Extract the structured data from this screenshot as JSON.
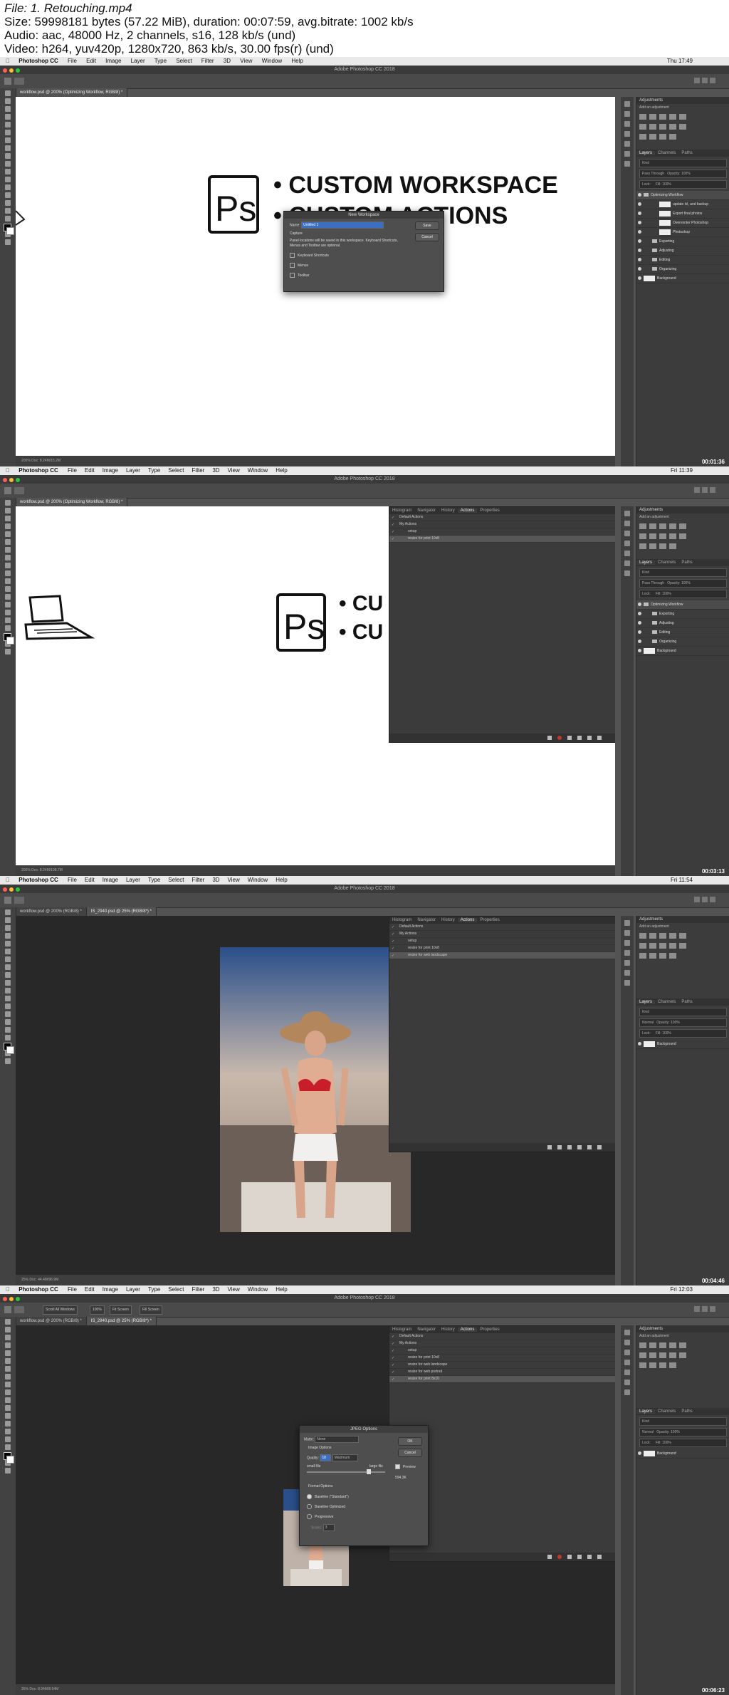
{
  "header": {
    "file": "File: 1. Retouching.mp4",
    "size": "Size: 59998181 bytes (57.22 MiB), duration: 00:07:59, avg.bitrate: 1002 kb/s",
    "audio": "Audio: aac, 48000 Hz, 2 channels, s16, 128 kb/s (und)",
    "video": "Video: h264, yuv420p, 1280x720, 863 kb/s, 30.00 fps(r) (und)"
  },
  "menu": {
    "app": "Photoshop CC",
    "items": [
      "File",
      "Edit",
      "Image",
      "Layer",
      "Type",
      "Select",
      "Filter",
      "3D",
      "View",
      "Window",
      "Help"
    ]
  },
  "window_title": "Adobe Photoshop CC 2018",
  "panels": {
    "adjustments": "Adjustments",
    "add_adjustment": "Add an adjustment",
    "layers_tabs": [
      "Layers",
      "Channels",
      "Paths"
    ],
    "kind": "Kind",
    "pass_through": "Pass Through",
    "normal": "Normal",
    "opacity": "Opacity: 100%",
    "lock": "Lock:",
    "fill": "Fill: 100%",
    "action_tabs": [
      "Histogram",
      "Navigator",
      "History",
      "Actions",
      "Properties"
    ]
  },
  "frames": [
    {
      "clock": "Thu 17:49",
      "tabs": [
        "workflow.psd @ 200% (Optimizing Workflow, RGB/8) *"
      ],
      "status": "200%    Doc: 8.24M/15.2M",
      "timestamp": "00:01:36",
      "drawing": {
        "line1": "• CUSTOM WORKSPACE",
        "line2": "• CUSTOM ACTIONS",
        "logo": "Ps"
      },
      "dialog": {
        "title": "New Workspace",
        "name_label": "Name:",
        "name_value": "Untitled 1",
        "save": "Save",
        "cancel": "Cancel",
        "capture": "Capture",
        "note": "Panel locations will be saved in this workspace. Keyboard Shortcuts, Menus and Toolbar are optional.",
        "options": [
          "Keyboard Shortcuts",
          "Menus",
          "Toolbar"
        ]
      },
      "layers": [
        {
          "name": "Optimizing Workflow",
          "type": "group"
        },
        {
          "name": "update lvl, and backup",
          "type": "sub-layer"
        },
        {
          "name": "Export final photos",
          "type": "sub-layer"
        },
        {
          "name": "Overexnter Photoshop",
          "type": "sub-layer"
        },
        {
          "name": "Photoshop",
          "type": "sub-layer"
        },
        {
          "name": "Exporting",
          "type": "sub-group"
        },
        {
          "name": "Adjusting",
          "type": "sub-group"
        },
        {
          "name": "Editing",
          "type": "sub-group"
        },
        {
          "name": "Organizing",
          "type": "sub-group"
        },
        {
          "name": "Background",
          "type": "layer"
        }
      ]
    },
    {
      "clock": "Fri 11:39",
      "tabs": [
        "workflow.psd @ 200% (Optimizing Workflow, RGB/8) *"
      ],
      "status": "200%    Doc: 8.24M/108.7M",
      "timestamp": "00:03:13",
      "drawing": {
        "line1": "• CU",
        "line2": "• CU",
        "logo": "Ps"
      },
      "actions": [
        "Default Actions",
        "My Actions",
        "setup",
        "resize for print 10x8"
      ],
      "layers": [
        {
          "name": "Optimizing Workflow",
          "type": "group"
        },
        {
          "name": "Exporting",
          "type": "sub-group"
        },
        {
          "name": "Adjusting",
          "type": "sub-group"
        },
        {
          "name": "Editing",
          "type": "sub-group"
        },
        {
          "name": "Organizing",
          "type": "sub-group"
        },
        {
          "name": "Background",
          "type": "layer"
        }
      ]
    },
    {
      "clock": "Fri 11:54",
      "tabs": [
        "workflow.psd @ 200% (RGB/8) *",
        "IS_2940.psd @ 25% (RGB/8*) *"
      ],
      "status": "25%    Doc: 44.4M/96.9M",
      "timestamp": "00:04:46",
      "actions": [
        "Default Actions",
        "My Actions",
        "setup",
        "resize for print 10x8",
        "resize for web landscape"
      ],
      "layers": [
        {
          "name": "Background",
          "type": "layer"
        }
      ]
    },
    {
      "clock": "Fri 12:03",
      "tabs": [
        "workflow.psd @ 200% (RGB/8) *",
        "IS_2940.psd @ 25% (RGB/8*) *"
      ],
      "status": "25%    Doc: 8.94M/8.94M",
      "timestamp": "00:06:23",
      "opt_buttons": [
        "Scroll All Windows",
        "100%",
        "Fit Screen",
        "Fill Screen"
      ],
      "actions": [
        "Default Actions",
        "My Actions",
        "setup",
        "resize for print 10x8",
        "resize for web landscape",
        "resize for web portrait",
        "resize for print 8x10"
      ],
      "jpeg": {
        "title": "JPEG Options",
        "matte_label": "Matte:",
        "matte_value": "None",
        "image_options": "Image Options",
        "quality_label": "Quality:",
        "quality_value": "10",
        "quality_level": "Maximum",
        "small_file": "small file",
        "large_file": "large file",
        "format_options": "Format Options",
        "formats": [
          "Baseline (\"Standard\")",
          "Baseline Optimized",
          "Progressive"
        ],
        "scans_label": "Scans:",
        "scans_value": "3",
        "ok": "OK",
        "cancel": "Cancel",
        "preview": "Preview",
        "size": "594.3K"
      },
      "layers": [
        {
          "name": "Background",
          "type": "layer"
        }
      ]
    }
  ],
  "colors": {
    "accent_blue": "#3a6fc4",
    "record_red": "#c0392b"
  }
}
